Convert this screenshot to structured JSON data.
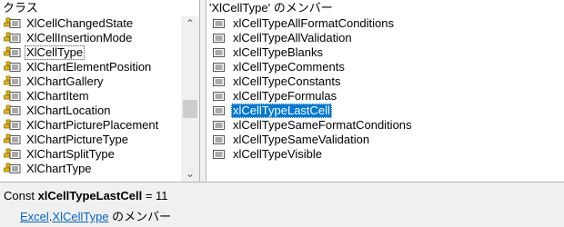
{
  "classes_pane": {
    "header": "クラス",
    "items": [
      {
        "label": "XlCellChangedState"
      },
      {
        "label": "XlCellInsertionMode"
      },
      {
        "label": "XlCellType"
      },
      {
        "label": "XlChartElementPosition"
      },
      {
        "label": "XlChartGallery"
      },
      {
        "label": "XlChartItem"
      },
      {
        "label": "XlChartLocation"
      },
      {
        "label": "XlChartPicturePlacement"
      },
      {
        "label": "XlChartPictureType"
      },
      {
        "label": "XlChartSplitType"
      },
      {
        "label": "XlChartType"
      }
    ],
    "boxed_index": 2,
    "icon": "enum-icon"
  },
  "scrollbar": {
    "up_glyph": "⌃",
    "down_glyph": "⌄"
  },
  "members_pane": {
    "header": "'XlCellType' のメンバー",
    "items": [
      {
        "label": "xlCellTypeAllFormatConditions"
      },
      {
        "label": "xlCellTypeAllValidation"
      },
      {
        "label": "xlCellTypeBlanks"
      },
      {
        "label": "xlCellTypeComments"
      },
      {
        "label": "xlCellTypeConstants"
      },
      {
        "label": "xlCellTypeFormulas"
      },
      {
        "label": "xlCellTypeLastCell"
      },
      {
        "label": "xlCellTypeSameFormatConditions"
      },
      {
        "label": "xlCellTypeSameValidation"
      },
      {
        "label": "xlCellTypeVisible"
      }
    ],
    "selected_index": 6,
    "icon": "constant-icon"
  },
  "detail": {
    "prefix": "Const ",
    "name": "xlCellTypeLastCell",
    "value": " = 11",
    "library_link": "Excel",
    "separator": ".",
    "class_link": "XlCellType",
    "suffix": " のメンバー"
  },
  "colors": {
    "selection": "#0078d7",
    "link": "#0066cc",
    "icon_yellow": "#e8b800"
  }
}
